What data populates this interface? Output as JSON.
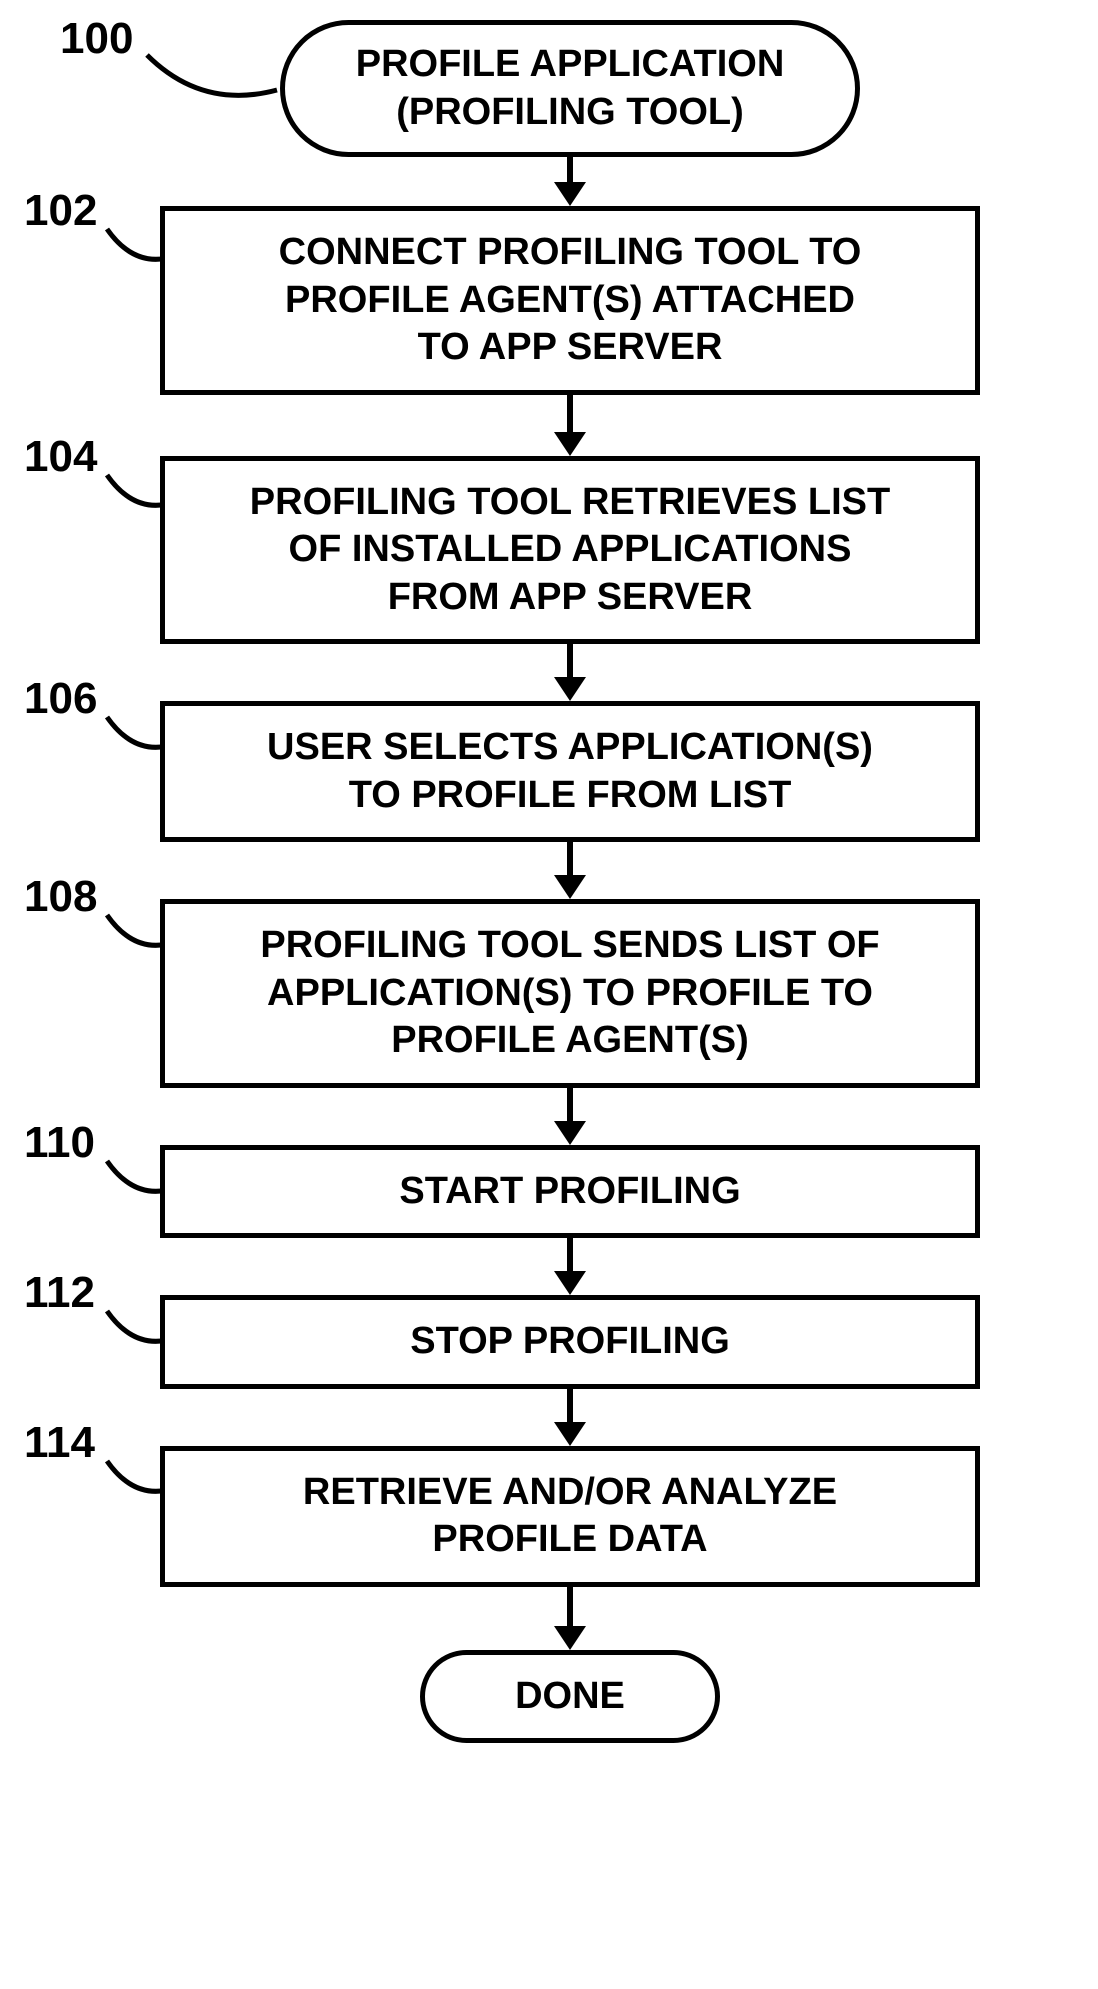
{
  "refs": {
    "r100": "100",
    "r102": "102",
    "r104": "104",
    "r106": "106",
    "r108": "108",
    "r110": "110",
    "r112": "112",
    "r114": "114"
  },
  "nodes": {
    "start_line1": "PROFILE APPLICATION",
    "start_line2": "(PROFILING TOOL)",
    "n102_line1": "CONNECT PROFILING TOOL TO",
    "n102_line2": "PROFILE AGENT(S) ATTACHED",
    "n102_line3": "TO APP SERVER",
    "n104_line1": "PROFILING TOOL RETRIEVES LIST",
    "n104_line2": "OF INSTALLED APPLICATIONS",
    "n104_line3": "FROM APP SERVER",
    "n106_line1": "USER SELECTS APPLICATION(S)",
    "n106_line2": "TO PROFILE FROM LIST",
    "n108_line1": "PROFILING TOOL SENDS LIST OF",
    "n108_line2": "APPLICATION(S) TO PROFILE TO",
    "n108_line3": "PROFILE AGENT(S)",
    "n110": "START PROFILING",
    "n112": "STOP PROFILING",
    "n114_line1": "RETRIEVE AND/OR ANALYZE",
    "n114_line2": "PROFILE DATA",
    "done": "DONE"
  }
}
